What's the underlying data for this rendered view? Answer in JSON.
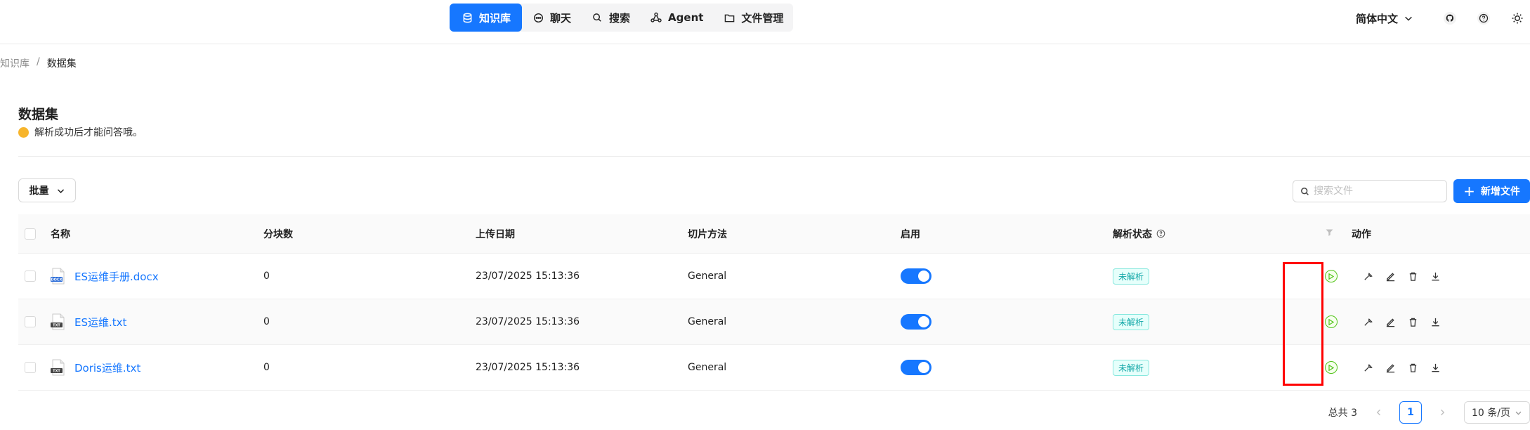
{
  "nav": {
    "items": [
      {
        "label": "知识库",
        "icon": "database-icon",
        "active": true
      },
      {
        "label": "聊天",
        "icon": "chat-icon",
        "active": false
      },
      {
        "label": "搜索",
        "icon": "search-icon",
        "active": false
      },
      {
        "label": "Agent",
        "icon": "agent-icon",
        "active": false
      },
      {
        "label": "文件管理",
        "icon": "folder-icon",
        "active": false
      }
    ]
  },
  "header": {
    "language": "简体中文"
  },
  "breadcrumb": {
    "root": "知识库",
    "separator": "/",
    "current": "数据集"
  },
  "page": {
    "title": "数据集",
    "subtitle": "解析成功后才能问答哦。"
  },
  "toolbar": {
    "bulk_label": "批量",
    "search_placeholder": "搜索文件",
    "add_label": "新增文件"
  },
  "table": {
    "columns": {
      "name": "名称",
      "chunks": "分块数",
      "upload_date": "上传日期",
      "method": "切片方法",
      "enabled": "启用",
      "status": "解析状态",
      "action": "动作"
    },
    "rows": [
      {
        "file_type": "DOCX",
        "name": "ES运维手册.docx",
        "chunks": "0",
        "date": "23/07/2025 15:13:36",
        "method": "General",
        "enabled": true,
        "status": "未解析"
      },
      {
        "file_type": "TXT",
        "name": "ES运维.txt",
        "chunks": "0",
        "date": "23/07/2025 15:13:36",
        "method": "General",
        "enabled": true,
        "status": "未解析"
      },
      {
        "file_type": "TXT",
        "name": "Doris运维.txt",
        "chunks": "0",
        "date": "23/07/2025 15:13:36",
        "method": "General",
        "enabled": true,
        "status": "未解析"
      }
    ]
  },
  "pagination": {
    "total": "总共 3",
    "current_page": "1",
    "page_size": "10 条/页"
  },
  "colors": {
    "primary": "#1677ff",
    "highlight": "#ff0000",
    "status_badge": "#13a8a8",
    "run": "#52c41a"
  }
}
